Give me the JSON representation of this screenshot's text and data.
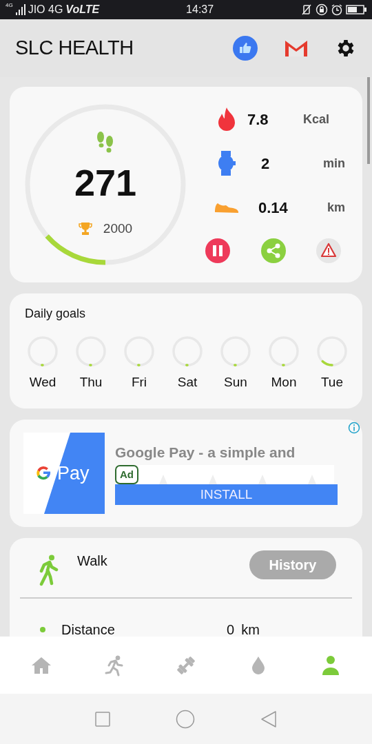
{
  "status_bar": {
    "network": "4G",
    "carrier": "JIO 4G",
    "volte": "VoLTE",
    "time": "14:37"
  },
  "app_bar": {
    "title": "SLC HEALTH"
  },
  "steps": {
    "count": "271",
    "goal": "2000",
    "level": 0.135
  },
  "stats": [
    {
      "kind": "calories",
      "value": "7.8",
      "unit": "Kcal"
    },
    {
      "kind": "time",
      "value": "2",
      "unit": "min"
    },
    {
      "kind": "distance",
      "value": "0.14",
      "unit": "km"
    }
  ],
  "actions": [
    {
      "kind": "pause"
    },
    {
      "kind": "share"
    },
    {
      "kind": "alert"
    }
  ],
  "daily_goals": {
    "title": "Daily goals",
    "days": [
      {
        "label": "Wed",
        "level": 0.01
      },
      {
        "label": "Thu",
        "level": 0.01
      },
      {
        "label": "Fri",
        "level": 0.01
      },
      {
        "label": "Sat",
        "level": 0.01
      },
      {
        "label": "Sun",
        "level": 0.01
      },
      {
        "label": "Mon",
        "level": 0.01
      },
      {
        "label": "Tue",
        "level": 0.12
      }
    ]
  },
  "ad": {
    "logo_text": "Pay",
    "headline": "Google Pay - a simple and",
    "badge": "Ad",
    "button": "INSTALL"
  },
  "activity": {
    "title": "Walk",
    "button": "History",
    "rows": [
      {
        "label": "Distance",
        "value": "0",
        "unit": "km"
      }
    ]
  },
  "bottom_nav": [
    {
      "kind": "home",
      "selected": false
    },
    {
      "kind": "run",
      "selected": false
    },
    {
      "kind": "workout",
      "selected": false
    },
    {
      "kind": "water",
      "selected": false
    },
    {
      "kind": "profile",
      "selected": true
    }
  ]
}
